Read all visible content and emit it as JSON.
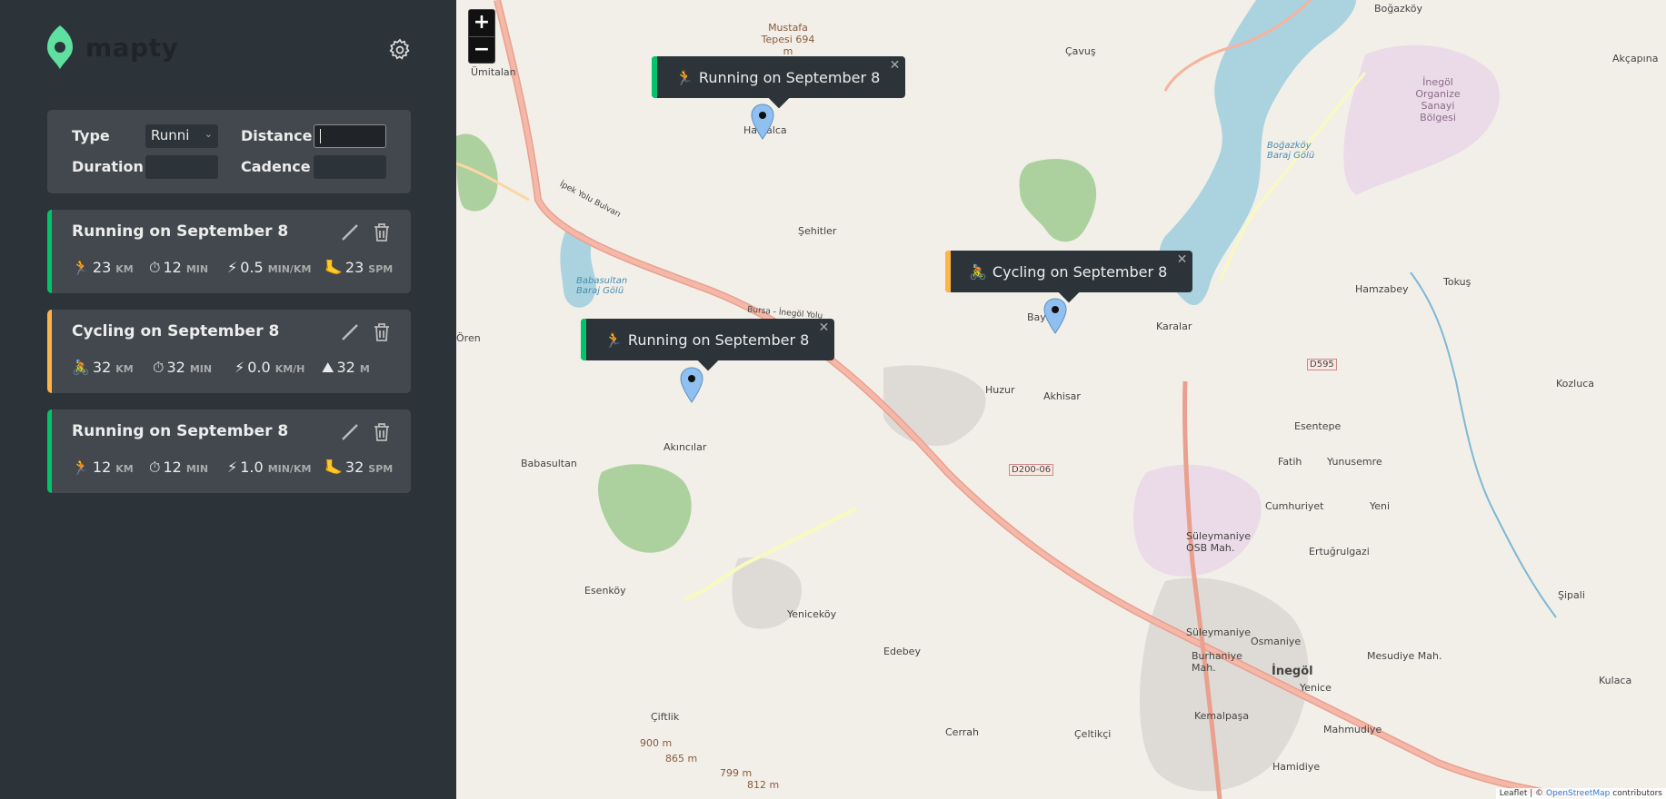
{
  "app": {
    "name": "mapty"
  },
  "form": {
    "type_label": "Type",
    "type_value": "Runni",
    "distance_label": "Distance",
    "duration_label": "Duration",
    "cadence_label": "Cadence"
  },
  "workouts": [
    {
      "title": "Running on September 8",
      "type": "running",
      "color": "#00c46a",
      "distance": "23",
      "distance_unit": "KM",
      "duration": "12",
      "duration_unit": "MIN",
      "pace": "0.5",
      "pace_unit": "MIN/KM",
      "extra": "23",
      "extra_unit": "SPM"
    },
    {
      "title": "Cycling on September 8",
      "type": "cycling",
      "color": "#ffb545",
      "distance": "32",
      "distance_unit": "KM",
      "duration": "32",
      "duration_unit": "MIN",
      "pace": "0.0",
      "pace_unit": "KM/H",
      "extra": "32",
      "extra_unit": "M"
    },
    {
      "title": "Running on September 8",
      "type": "running",
      "color": "#00c46a",
      "distance": "12",
      "distance_unit": "KM",
      "duration": "12",
      "duration_unit": "MIN",
      "pace": "1.0",
      "pace_unit": "MIN/KM",
      "extra": "32",
      "extra_unit": "SPM"
    }
  ],
  "map": {
    "zoom_in": "+",
    "zoom_out": "−",
    "popups": [
      {
        "label": "Running on September 8",
        "icon": "🏃",
        "color": "#00c46a"
      },
      {
        "label": "Cycling on September 8",
        "icon": "🚴",
        "color": "#ffb545"
      },
      {
        "label": "Running on September 8",
        "icon": "🏃",
        "color": "#00c46a"
      }
    ],
    "places": [
      "Boğazköy",
      "Ümitalan",
      "Mustafa Tepesi 694 m",
      "Çavuş",
      "Halhalca",
      "Şehitler",
      "Babasultan Baraj Gölü",
      "Hamzabey",
      "Tokuş",
      "Karalar",
      "Bayırca",
      "Huzur",
      "Akhisar",
      "Ören",
      "Akıncılar",
      "Babasultan",
      "Esentepe",
      "Fatih",
      "Yunusemre",
      "Kozluca",
      "Cumhuriyet",
      "Yeni",
      "Süleymaniye OSB Mah.",
      "Ertuğrulgazi",
      "Esenköy",
      "Yeniceköy",
      "Edebey",
      "Süleymaniye",
      "Osmaniye",
      "Mesudiye Mah.",
      "Şipali",
      "Burhaniye Mah.",
      "İnegöl",
      "Yenice",
      "Kulaca",
      "Kemalpaşa",
      "Mahmudiye",
      "Çiftlik",
      "900 m",
      "865 m",
      "799 m",
      "812 m",
      "Cerrah",
      "Çeltikçi",
      "Hamidiye",
      "Akçapına",
      "İnegöl Organize Sanayi Bölgesi",
      "Boğazköy Baraj Gölü",
      "D595",
      "D200-06",
      "Bursa - İnegöl Yolu",
      "İpek Yolu Bulvarı"
    ],
    "attribution_prefix": "Leaflet | © ",
    "attribution_link": "OpenStreetMap",
    "attribution_suffix": " contributors"
  }
}
